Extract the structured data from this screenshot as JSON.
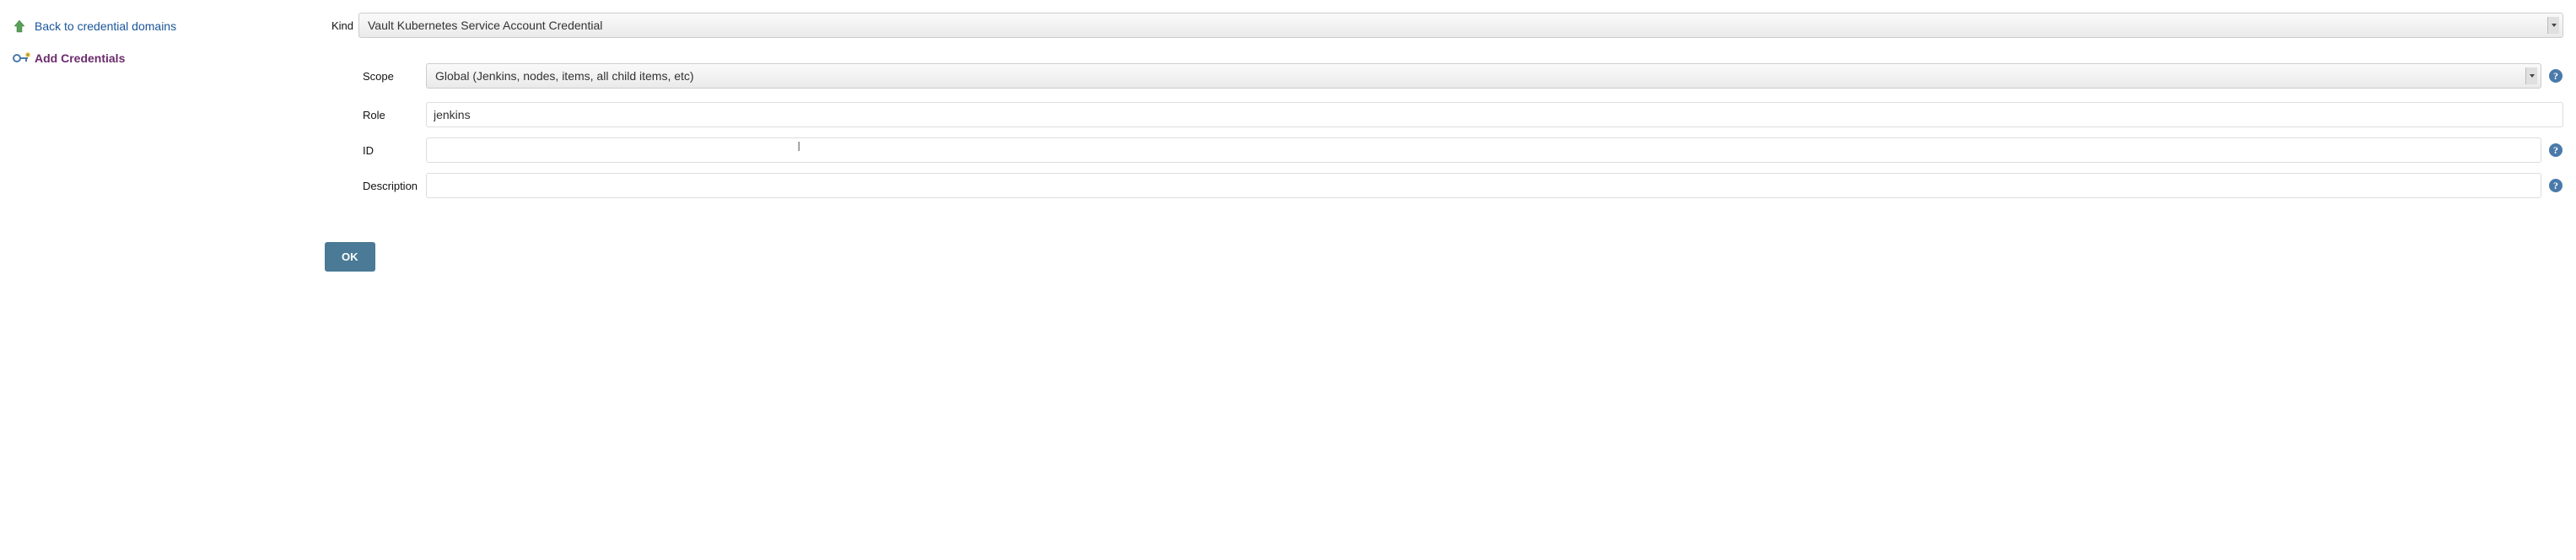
{
  "sidebar": {
    "back_label": "Back to credential domains",
    "add_label": "Add Credentials"
  },
  "form": {
    "kind_label": "Kind",
    "kind_value": "Vault Kubernetes Service Account Credential",
    "scope_label": "Scope",
    "scope_value": "Global (Jenkins, nodes, items, all child items, etc)",
    "role_label": "Role",
    "role_value": "jenkins",
    "id_label": "ID",
    "id_value": "",
    "description_label": "Description",
    "description_value": ""
  },
  "button": {
    "ok": "OK"
  }
}
